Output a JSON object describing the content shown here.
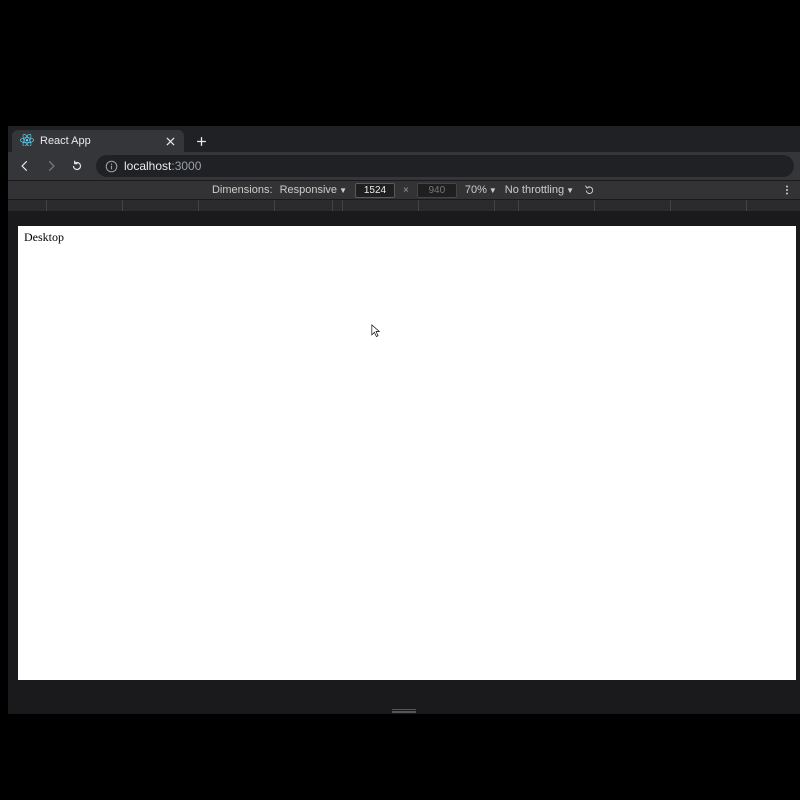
{
  "tab": {
    "title": "React App"
  },
  "url": {
    "host": "localhost",
    "port": ":3000"
  },
  "devtools": {
    "dimensions_label": "Dimensions:",
    "dimensions_mode": "Responsive",
    "width": "1524",
    "height": "940",
    "multiply": "×",
    "zoom": "70%",
    "throttling": "No throttling"
  },
  "page": {
    "text": "Desktop"
  }
}
